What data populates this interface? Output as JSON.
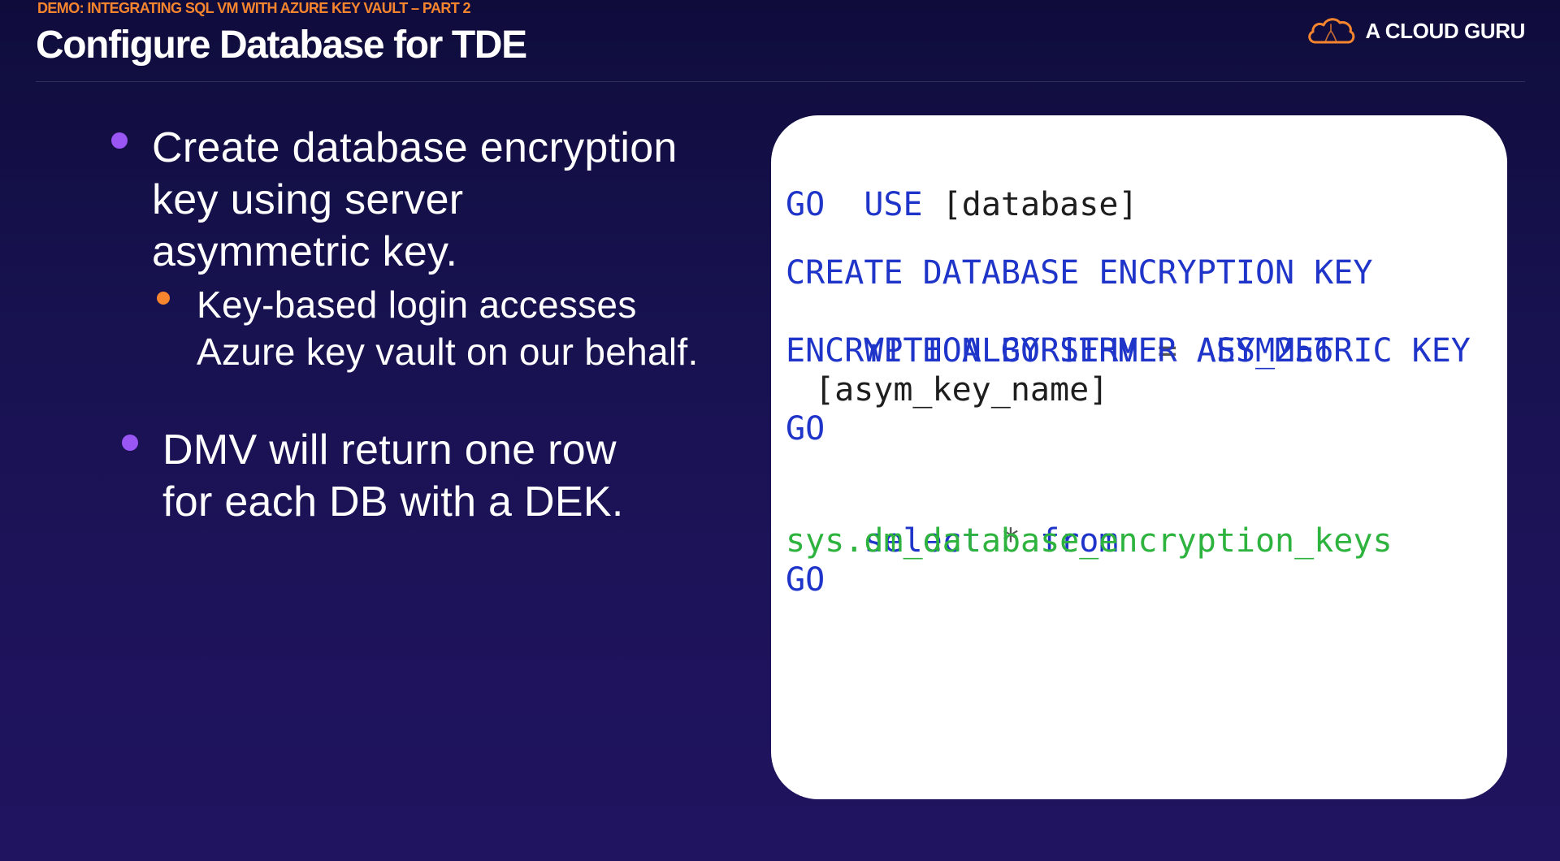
{
  "header": {
    "kicker": "DEMO: INTEGRATING SQL VM WITH AZURE KEY VAULT – PART 2",
    "title": "Configure Database for TDE",
    "brand": {
      "name": "A CLOUD GURU",
      "icon": "cloud-logo-icon",
      "accent": "#f7852e"
    }
  },
  "bullets": {
    "item1": {
      "lines": [
        "Create database encryption",
        "key using server",
        "asymmetric key."
      ],
      "sub": {
        "lines": [
          "Key-based login accesses",
          "Azure key vault on our behalf."
        ]
      }
    },
    "item2": {
      "lines": [
        "DMV will return one row",
        "for each DB with a DEK."
      ]
    }
  },
  "code": {
    "use_kw": "USE",
    "use_arg": "[database]",
    "go1": "GO",
    "create": "CREATE DATABASE ENCRYPTION KEY",
    "with_kw": "WITH ALGORITHM",
    "eq": "=",
    "algo": "AES_256",
    "enc_by": "ENCRYPTION BY SERVER ASYMMETRIC KEY",
    "key_name": "[asym_key_name]",
    "go2": "GO",
    "select_kw": "select",
    "star": "*",
    "from_kw": "from",
    "dmv": "sys.dm_database_encryption_keys",
    "go3": "GO"
  },
  "colors": {
    "keyword": "#1f34c8",
    "system_object": "#2db33e",
    "bullet_level1": "#9a55f5",
    "bullet_level2": "#f7852e",
    "kicker": "#f7852e"
  }
}
